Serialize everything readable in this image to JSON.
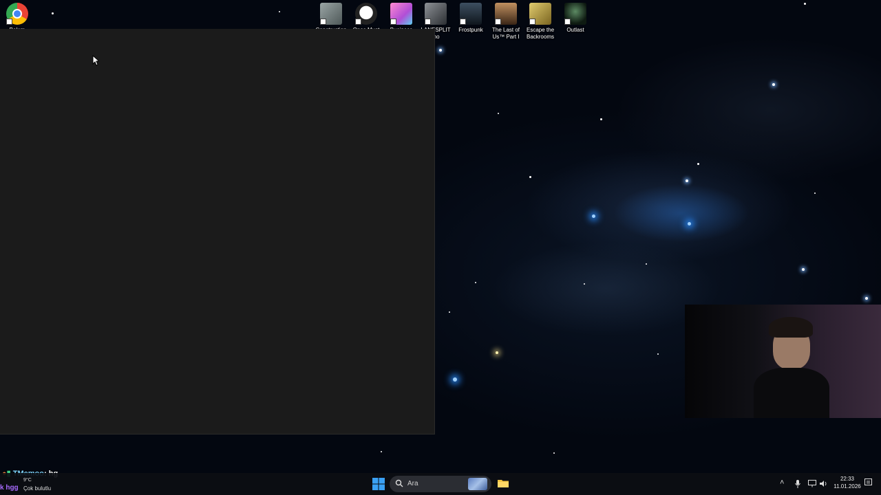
{
  "desktop": {
    "icons": [
      {
        "name": "chrome",
        "label": "Bakım",
        "color": "#4285f4"
      },
      {
        "name": "construction",
        "label": "Construction",
        "color": "#7d8a8a"
      },
      {
        "name": "ones-must",
        "label": "Ones Must",
        "color": "#d8d8d8"
      },
      {
        "name": "business-tour",
        "label": "Business Tour",
        "color": "#e25aa6"
      },
      {
        "name": "lanesplit",
        "label": "LANESPLIT mo",
        "color": "#555a60"
      },
      {
        "name": "frostpunk",
        "label": "Frostpunk",
        "color": "#2b3a48"
      },
      {
        "name": "the-last-of-us",
        "label": "The Last of Us™ Part I",
        "color": "#7a5a3c"
      },
      {
        "name": "escape-the-backrooms",
        "label": "Escape the Backrooms",
        "color": "#c2a64a"
      },
      {
        "name": "outlast",
        "label": "Outlast",
        "color": "#2f4a35"
      }
    ]
  },
  "chat_overlay": {
    "username": "TMemoo",
    "message": ": hg"
  },
  "taskbar": {
    "weather": {
      "prefix": "k hgg",
      "temp": "9°C",
      "desc": "Çok bulutlu"
    },
    "search_placeholder": "Ara",
    "clock": {
      "time": "22:33",
      "date": "11.01.2026"
    }
  }
}
